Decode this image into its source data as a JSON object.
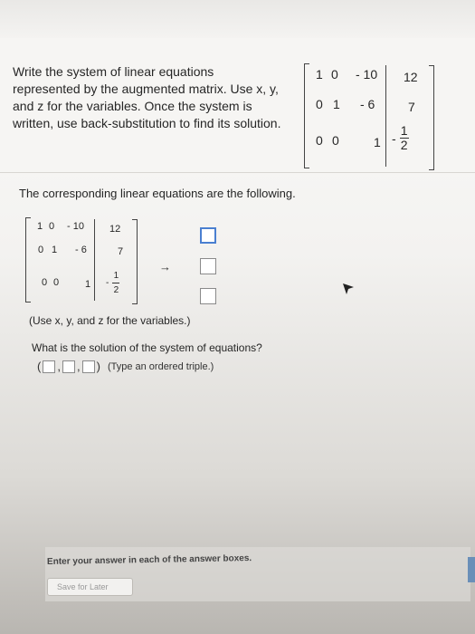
{
  "question": {
    "prompt": "Write the system of linear equations represented by the augmented matrix. Use x, y, and z for the variables. Once the system is written, use back-substitution to find its solution."
  },
  "matrix": {
    "rows": [
      [
        "1",
        "0",
        "- 10",
        "12"
      ],
      [
        "0",
        "1",
        "- 6",
        "7"
      ],
      [
        "0",
        "0",
        "1",
        "-",
        "1",
        "2"
      ]
    ]
  },
  "work": {
    "intro": "The corresponding linear equations are the following.",
    "arrow": "→",
    "variables_note": "(Use x, y, and z for the variables.)",
    "solution_question": "What is the solution of the system of equations?",
    "triple_hint": "(Type an ordered triple.)"
  },
  "footer": {
    "instruction": "Enter your answer in each of the answer boxes.",
    "save_label": "Save for Later"
  },
  "colors": {
    "active_box": "#4a7fd0",
    "box_border": "#8a8a8a"
  }
}
